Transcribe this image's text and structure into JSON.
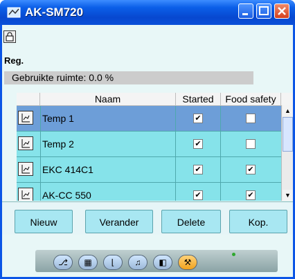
{
  "window": {
    "title": "AK-SM720",
    "minimize_label": "_",
    "maximize_label": "□",
    "close_label": "×"
  },
  "toolbar": {
    "lock_icon": "lock-icon"
  },
  "header": {
    "section": "Reg."
  },
  "usage": {
    "text": "Gebruikte ruimte: 0.0 %"
  },
  "table": {
    "columns": [
      "",
      "Naam",
      "Started",
      "Food safety"
    ],
    "rows": [
      {
        "name": "Temp 1",
        "started": true,
        "food_safety": false,
        "selected": true
      },
      {
        "name": "Temp 2",
        "started": true,
        "food_safety": false,
        "selected": false
      },
      {
        "name": "EKC 414C1",
        "started": true,
        "food_safety": true,
        "selected": false
      },
      {
        "name": "AK-CC 550",
        "started": true,
        "food_safety": true,
        "selected": false
      }
    ]
  },
  "buttons": {
    "new": "Nieuw",
    "change": "Verander",
    "delete": "Delete",
    "copy": "Kop."
  },
  "nav": {
    "items": [
      "tree-icon",
      "grid-icon",
      "graph-icon",
      "bell-icon",
      "history-icon",
      "tool-icon"
    ]
  },
  "colors": {
    "title_blue": "#0a55e6",
    "row_teal": "#86e3ea",
    "row_selected": "#6d9ed8",
    "button": "#a8e7f2"
  }
}
